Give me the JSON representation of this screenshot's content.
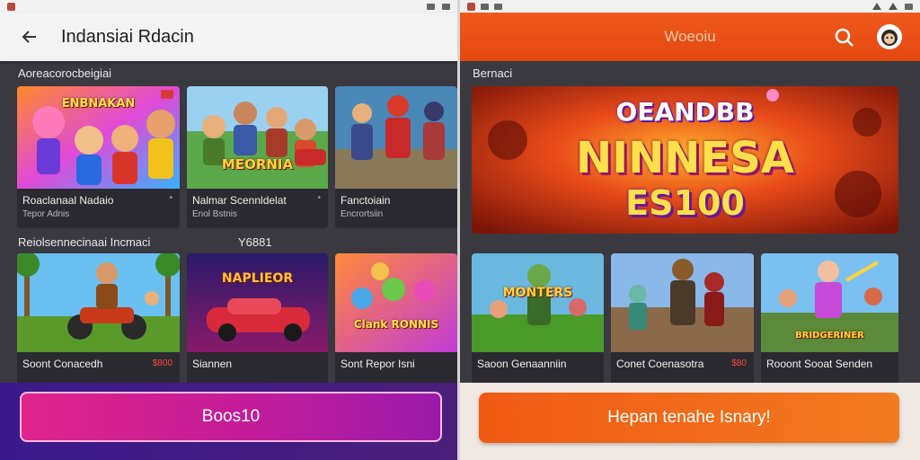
{
  "left": {
    "appbar": {
      "title": "Indansiai Rdacin"
    },
    "section1": {
      "label": "Aoreacorocbeigiai"
    },
    "section2": {
      "label": "Reiolsennecinaai Incmaci",
      "aside": "Y6881"
    },
    "row1": [
      {
        "art_text": "ENBNAKAN",
        "name": "Roaclanaal Nadaio",
        "sub": "Tepor Adnis"
      },
      {
        "art_text": "MEORNIA",
        "name": "Nalmar Scennldelat",
        "sub": "Enol Bstnis"
      },
      {
        "art_text": "",
        "name": "Fanctoiain",
        "sub": "Encrortsiin"
      }
    ],
    "row2": [
      {
        "art_text": "",
        "name": "Soont Conacedh",
        "sub": "",
        "price": "$800"
      },
      {
        "art_text": "NAPLIEOR",
        "name": "Siannen",
        "sub": ""
      },
      {
        "art_text": "Clank RONNIS",
        "name": "Sont Repor Isni",
        "sub": ""
      }
    ],
    "cta": {
      "label": "Boos10"
    }
  },
  "right": {
    "appbar": {
      "title": "Woeoiu"
    },
    "section1": {
      "label": "Bernaci"
    },
    "hero": {
      "line1": "OEANDBB",
      "line2": "NINNESA",
      "line3": "ES100"
    },
    "row1": [
      {
        "art_text": "MONTERS",
        "name": "Saoon Genaanniin",
        "sub": ""
      },
      {
        "art_text": "",
        "name": "Conet Coenasotra",
        "sub": "",
        "price": "$80"
      },
      {
        "art_text": "BRIDGERINER",
        "name": "Rooont Sooat Senden",
        "sub": ""
      }
    ],
    "cta": {
      "label": "Hepan tenahe Isnary!"
    }
  },
  "colors": {
    "accent_orange": "#f0541a",
    "cta_magenta": "#d81f8f",
    "price_red": "#ff4a3a"
  },
  "icons": [
    "back-arrow-icon",
    "search-icon",
    "avatar-icon",
    "more-icon"
  ]
}
